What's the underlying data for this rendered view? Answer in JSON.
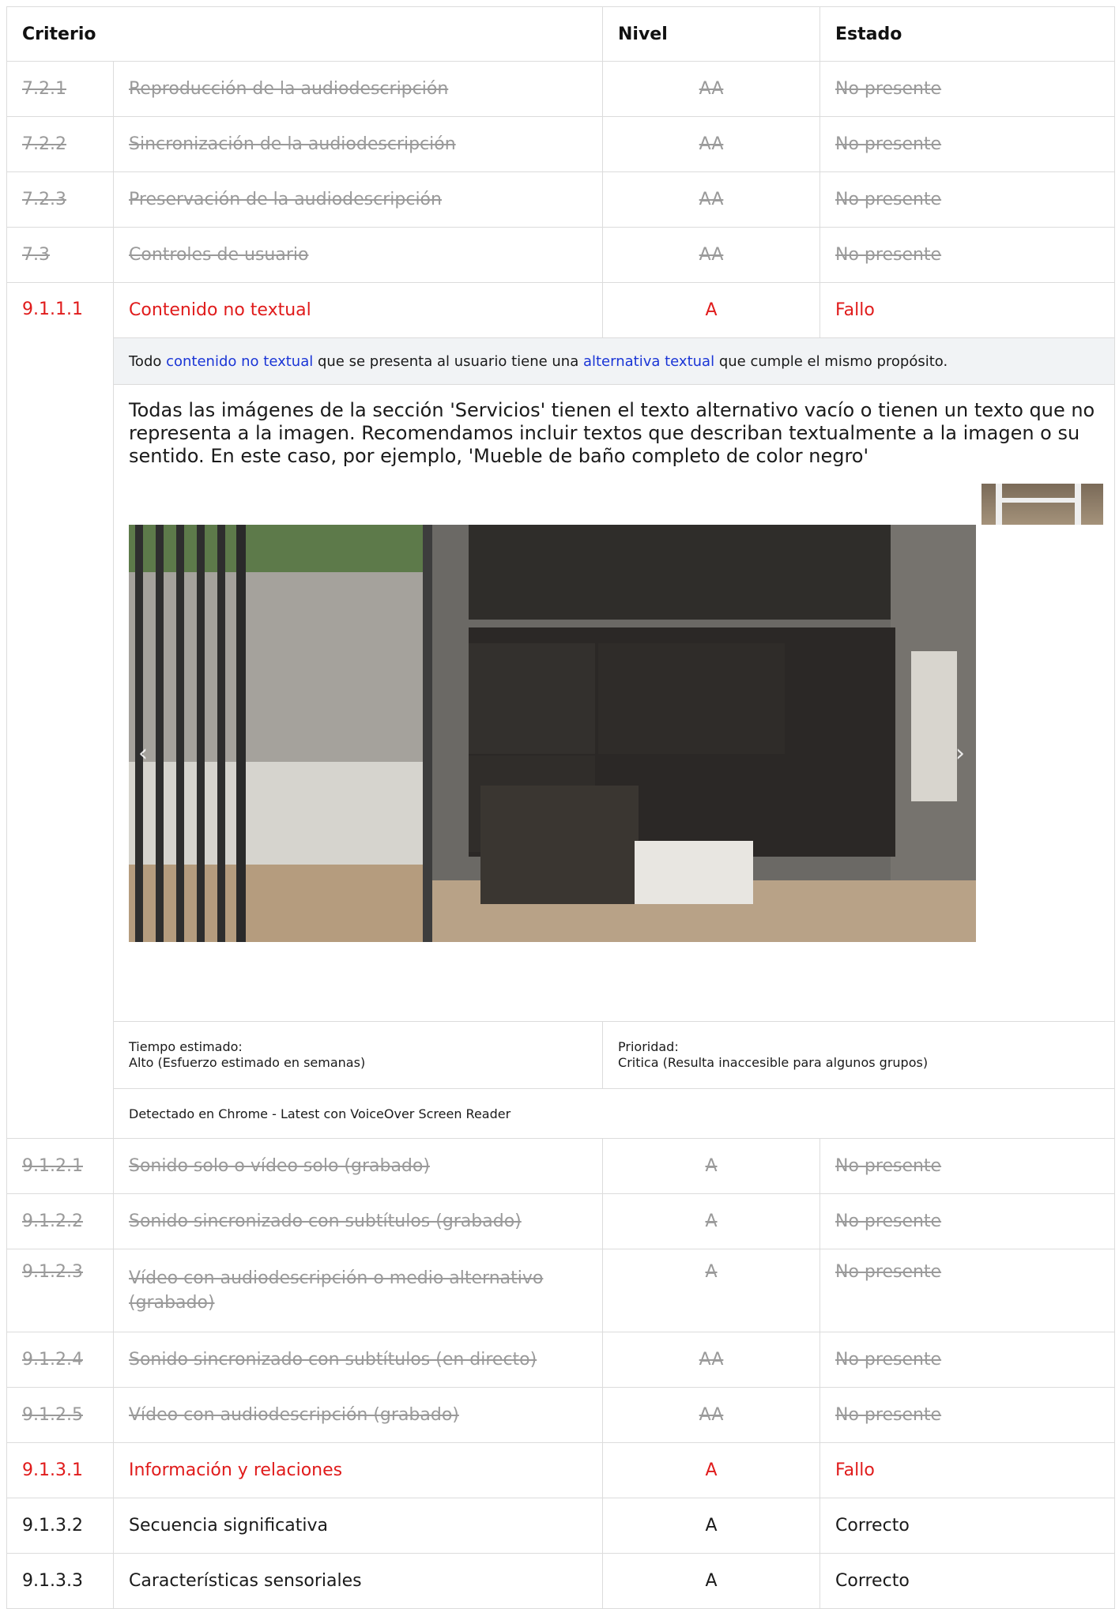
{
  "headers": {
    "criterio": "Criterio",
    "nivel": "Nivel",
    "estado": "Estado"
  },
  "rows_before": [
    {
      "code": "7.2.1",
      "name": "Reproducción de la audiodescripción",
      "level": "AA",
      "status": "No presente"
    },
    {
      "code": "7.2.2",
      "name": "Sincronización de la audiodescripción",
      "level": "AA",
      "status": "No presente"
    },
    {
      "code": "7.2.3",
      "name": "Preservación de la audiodescripción",
      "level": "AA",
      "status": "No presente"
    },
    {
      "code": "7.3",
      "name": "Controles de usuario",
      "level": "AA",
      "status": "No presente"
    }
  ],
  "failed_row": {
    "code": "9.1.1.1",
    "name": "Contenido no textual",
    "level": "A",
    "status": "Fallo"
  },
  "guideline": {
    "part1": "Todo ",
    "link1": "contenido no textual",
    "part2": " que se presenta al usuario tiene una ",
    "link2": "alternativa textual",
    "part3": " que cumple el mismo propósito."
  },
  "observation": "Todas las imágenes de la sección 'Servicios' tienen el texto alternativo vacío o tienen un texto que no representa a la imagen. Recomendamos incluir textos que describan textualmente a la imagen o su sentido. En este caso, por ejemplo, 'Mueble de baño completo de color negro'",
  "carousel": {
    "prev_icon": "chevron-left-icon",
    "next_icon": "chevron-right-icon",
    "prev_glyph": "‹",
    "next_glyph": "›"
  },
  "estimate": {
    "label": "Tiempo estimado:",
    "value": "Alto (Esfuerzo estimado en semanas)"
  },
  "priority": {
    "label": "Prioridad:",
    "value": "Critica (Resulta inaccesible para algunos grupos)"
  },
  "detected": "Detectado en Chrome - Latest con VoiceOver Screen Reader",
  "rows_after": [
    {
      "code": "9.1.2.1",
      "name": "Sonido solo o vídeo solo (grabado)",
      "level": "A",
      "status": "No presente",
      "state": "na"
    },
    {
      "code": "9.1.2.2",
      "name": "Sonido sincronizado con subtítulos (grabado)",
      "level": "A",
      "status": "No presente",
      "state": "na"
    },
    {
      "code": "9.1.2.3",
      "name": "Vídeo con audiodescripción o medio alternativo (grabado)",
      "level": "A",
      "status": "No presente",
      "state": "na"
    },
    {
      "code": "9.1.2.4",
      "name": "Sonido sincronizado con subtítulos (en directo)",
      "level": "AA",
      "status": "No presente",
      "state": "na"
    },
    {
      "code": "9.1.2.5",
      "name": "Vídeo con audiodescripción (grabado)",
      "level": "AA",
      "status": "No presente",
      "state": "na"
    },
    {
      "code": "9.1.3.1",
      "name": "Información y relaciones",
      "level": "A",
      "status": "Fallo",
      "state": "fail"
    },
    {
      "code": "9.1.3.2",
      "name": "Secuencia significativa",
      "level": "A",
      "status": "Correcto",
      "state": "pass"
    },
    {
      "code": "9.1.3.3",
      "name": "Características sensoriales",
      "level": "A",
      "status": "Correcto",
      "state": "pass"
    }
  ],
  "colors": {
    "fail": "#e01b1b",
    "na": "#9a9a9a",
    "link": "#1a35d6",
    "guideline_bg": "#f1f3f5",
    "border": "#dcdcdc"
  }
}
